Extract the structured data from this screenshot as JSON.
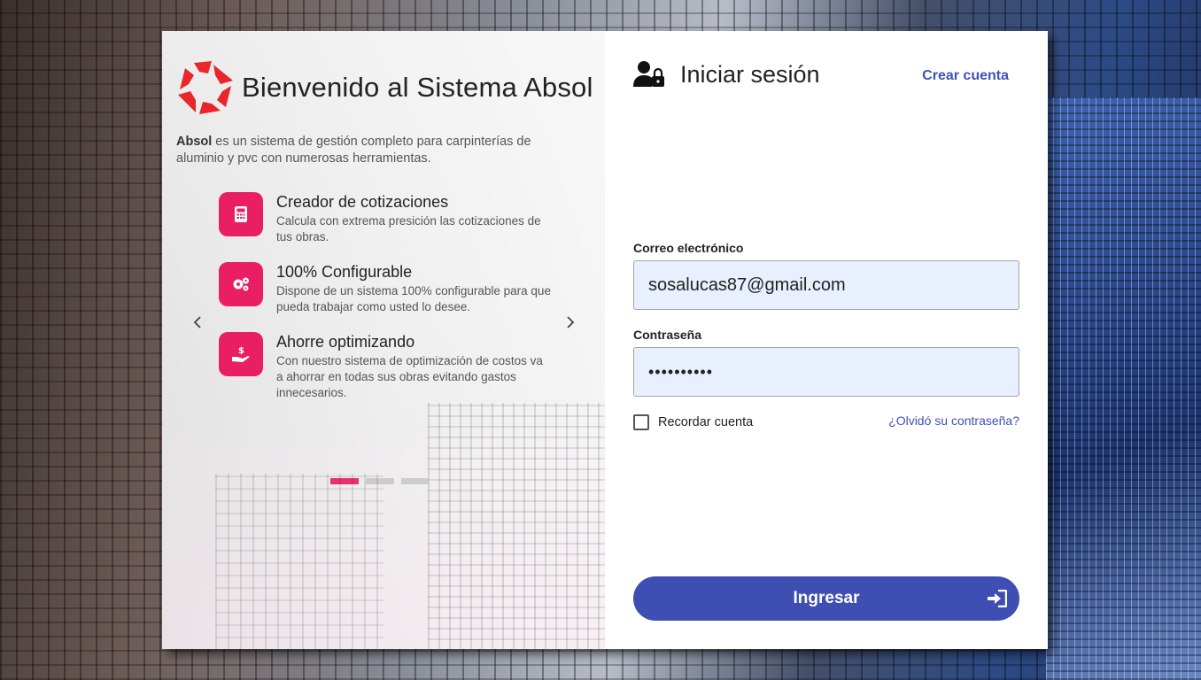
{
  "brand": {
    "title": "Bienvenido al Sistema Absol",
    "logo_icon": "absol-logo-icon",
    "accent_color": "#e91e63"
  },
  "intro": {
    "bold": "Absol",
    "text": " es un sistema de gestión completo para carpinterías de aluminio y pvc con numerosas herramientas."
  },
  "features": [
    {
      "icon": "calculator-icon",
      "title": "Creador de cotizaciones",
      "desc": "Calcula con extrema presición las cotizaciones de tus obras."
    },
    {
      "icon": "gears-icon",
      "title": "100% Configurable",
      "desc": "Dispone de un sistema 100% configurable para que pueda trabajar como usted lo desee."
    },
    {
      "icon": "hand-money-icon",
      "title": "Ahorre optimizando",
      "desc": "Con nuestro sistema de optimización de costos va a ahorrar en todas sus obras evitando gastos innecesarios."
    }
  ],
  "carousel": {
    "active_index": 0,
    "count": 3,
    "active_color": "#e6336e"
  },
  "login": {
    "title": "Iniciar sesión",
    "create_account": "Crear cuenta",
    "email_label": "Correo electrónico",
    "email_value": "sosalucas87@gmail.com",
    "password_label": "Contraseña",
    "password_value": "••••••••••",
    "remember_label": "Recordar cuenta",
    "remember_checked": false,
    "forgot_link": "¿Olvidó su contraseña?",
    "submit_label": "Ingresar",
    "button_color": "#3f4eb2",
    "link_color": "#3f51b5"
  }
}
